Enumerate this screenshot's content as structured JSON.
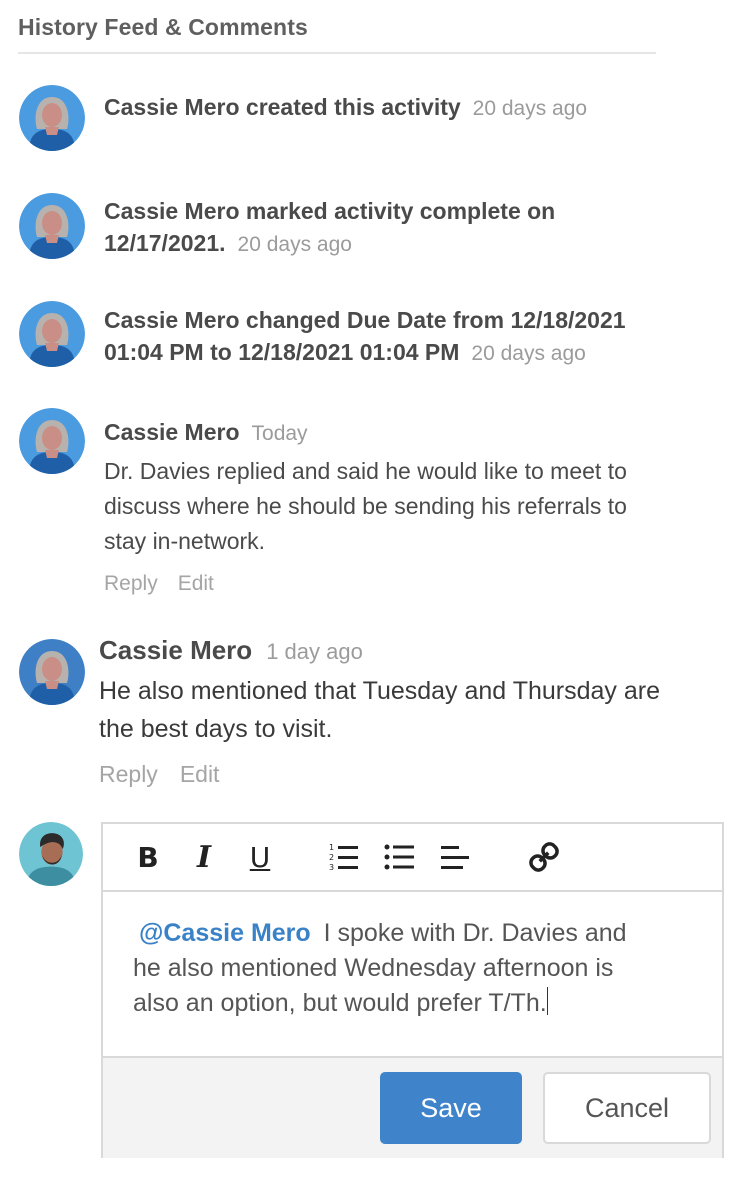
{
  "header": {
    "title": "History Feed & Comments"
  },
  "history": [
    {
      "text": "Cassie Mero created this activity",
      "time": "20 days ago"
    },
    {
      "text_line1": "Cassie Mero marked activity complete on",
      "text_line2": "12/17/2021.",
      "time": "20 days ago"
    },
    {
      "text_line1": "Cassie Mero changed Due Date from 12/18/2021",
      "text_line2": "01:04 PM to 12/18/2021 01:04 PM",
      "time": "20 days ago"
    }
  ],
  "comments": [
    {
      "name": "Cassie Mero",
      "time": "Today",
      "body_lines": [
        "Dr. Davies replied and said he would like to meet to",
        "discuss where he should be sending his referrals to",
        "stay in-network."
      ],
      "reply": "Reply",
      "edit": "Edit"
    },
    {
      "name": "Cassie Mero",
      "time": "1 day ago",
      "body_lines": [
        "He also mentioned that Tuesday and Thursday are",
        "the best days to visit."
      ],
      "reply": "Reply",
      "edit": "Edit"
    }
  ],
  "editor": {
    "toolbar": {
      "bold": "B",
      "italic": "I",
      "underline": "U"
    },
    "mention": "@Cassie Mero",
    "lines": [
      "I spoke with Dr. Davies and",
      "he also mentioned Wednesday afternoon is",
      "also an option, but would prefer T/Th."
    ],
    "save_label": "Save",
    "cancel_label": "Cancel"
  },
  "colors": {
    "accent": "#3f84cb",
    "mention": "#3a82c8",
    "muted": "#9b9b9b"
  }
}
